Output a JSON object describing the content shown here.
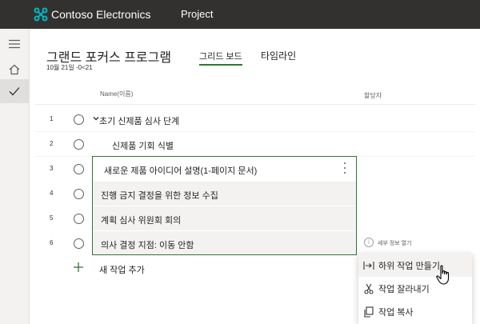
{
  "header": {
    "brand": "Contoso Electronics",
    "app": "Project"
  },
  "rail": {
    "icons": [
      "hamburger-icon",
      "home-icon",
      "checkmark-icon"
    ],
    "active_index": 2
  },
  "plan": {
    "title": "그랜드 포커스 프로그램",
    "date": "10월 21일 -0<21"
  },
  "tabs": {
    "grid": "그리드 보드",
    "timeline": "타임라인"
  },
  "columns": {
    "name": "Name(이름)",
    "assigned": "할당자"
  },
  "tasks": [
    {
      "num": "1",
      "name": "초기 신제품 심사 단계"
    },
    {
      "num": "2",
      "name": "신제품 기회 식별"
    },
    {
      "num": "3",
      "name": "새로운 제품 아이디어 설명(1-페이지 문서)"
    },
    {
      "num": "4",
      "name": "진행 금지 결정을 위한 정보 수집"
    },
    {
      "num": "5",
      "name": "계획 심사 위원회 회의"
    },
    {
      "num": "6",
      "name": "의사 결정 지점: 이동 안함"
    }
  ],
  "add_task": "새 작업 추가",
  "details": "세부 정보 열기",
  "context_menu": [
    {
      "label": "하위 작업 만들기",
      "icon": "subtask-icon"
    },
    {
      "label": "작업 잘라내기",
      "icon": "scissors-icon"
    },
    {
      "label": "작업 복사",
      "icon": "copy-icon"
    }
  ],
  "colors": {
    "topbar": "#323130",
    "accent": "#31752f",
    "brand_icon": "#00b7c3"
  }
}
